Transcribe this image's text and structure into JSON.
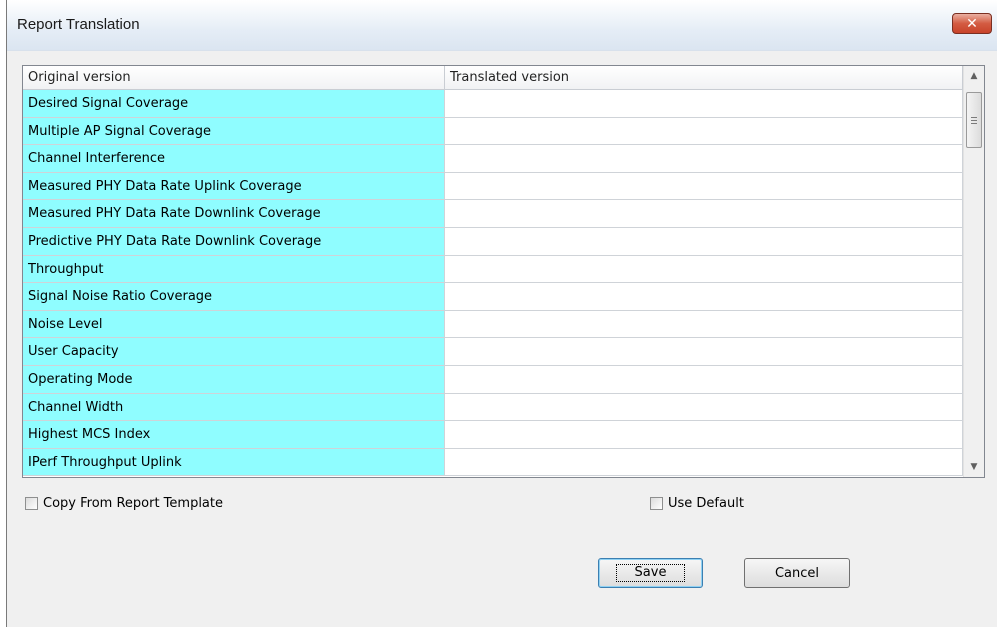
{
  "window": {
    "title": "Report Translation",
    "close_glyph": "✕"
  },
  "table": {
    "columns": [
      "Original version",
      "Translated version"
    ],
    "rows": [
      {
        "original": "Desired Signal Coverage",
        "translated": ""
      },
      {
        "original": "Multiple AP Signal Coverage",
        "translated": ""
      },
      {
        "original": "Channel Interference",
        "translated": ""
      },
      {
        "original": "Measured PHY Data Rate Uplink Coverage",
        "translated": ""
      },
      {
        "original": "Measured PHY Data Rate Downlink Coverage",
        "translated": ""
      },
      {
        "original": "Predictive PHY Data Rate Downlink Coverage",
        "translated": ""
      },
      {
        "original": "Throughput",
        "translated": ""
      },
      {
        "original": "Signal Noise Ratio Coverage",
        "translated": ""
      },
      {
        "original": "Noise Level",
        "translated": ""
      },
      {
        "original": "User Capacity",
        "translated": ""
      },
      {
        "original": "Operating Mode",
        "translated": ""
      },
      {
        "original": "Channel Width",
        "translated": ""
      },
      {
        "original": "Highest MCS Index",
        "translated": ""
      },
      {
        "original": "IPerf Throughput Uplink",
        "translated": ""
      }
    ],
    "scroll_up_glyph": "▲",
    "scroll_down_glyph": "▼"
  },
  "options": {
    "copy_from_template_label": "Copy From Report Template",
    "copy_from_template_checked": false,
    "use_default_label": "Use Default",
    "use_default_checked": false
  },
  "buttons": {
    "save_label": "Save",
    "cancel_label": "Cancel"
  },
  "colors": {
    "original_column_bg": "#8ffdff",
    "close_button_red": "#c8432a"
  }
}
